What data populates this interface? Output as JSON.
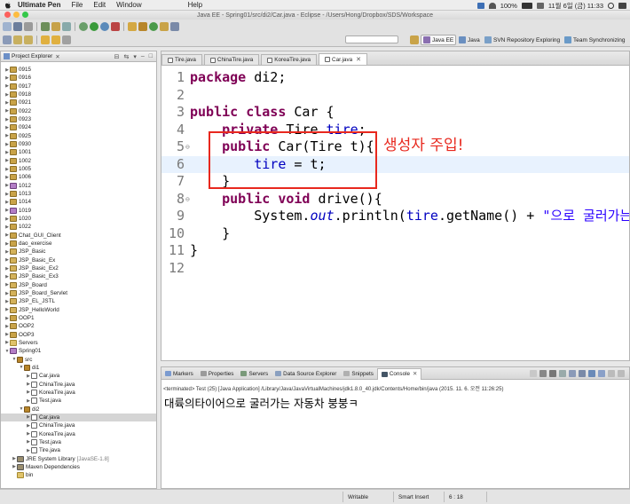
{
  "menubar": {
    "app_name": "Ultimate Pen",
    "items": [
      "File",
      "Edit",
      "Window",
      "Help"
    ],
    "battery": "100%",
    "datetime": "11월 6일 (금)  11:33"
  },
  "window": {
    "title": "Java EE - Spring01/src/di2/Car.java - Eclipse - /Users/Hong/Dropbox/SDS/Workspace"
  },
  "perspectives": [
    {
      "label": "Java EE",
      "active": true
    },
    {
      "label": "Java",
      "active": false
    },
    {
      "label": "SVN Repository Exploring",
      "active": false
    },
    {
      "label": "Team Synchronizing",
      "active": false
    }
  ],
  "explorer": {
    "title": "Project Explorer",
    "tree": [
      {
        "label": "0915",
        "depth": 0,
        "twisty": "▶",
        "icon": "project"
      },
      {
        "label": "0916",
        "depth": 0,
        "twisty": "▶",
        "icon": "project"
      },
      {
        "label": "0917",
        "depth": 0,
        "twisty": "▶",
        "icon": "project"
      },
      {
        "label": "0918",
        "depth": 0,
        "twisty": "▶",
        "icon": "project"
      },
      {
        "label": "0921",
        "depth": 0,
        "twisty": "▶",
        "icon": "project"
      },
      {
        "label": "0922",
        "depth": 0,
        "twisty": "▶",
        "icon": "project"
      },
      {
        "label": "0923",
        "depth": 0,
        "twisty": "▶",
        "icon": "project"
      },
      {
        "label": "0924",
        "depth": 0,
        "twisty": "▶",
        "icon": "project"
      },
      {
        "label": "0925",
        "depth": 0,
        "twisty": "▶",
        "icon": "project"
      },
      {
        "label": "0930",
        "depth": 0,
        "twisty": "▶",
        "icon": "project"
      },
      {
        "label": "1001",
        "depth": 0,
        "twisty": "▶",
        "icon": "project"
      },
      {
        "label": "1002",
        "depth": 0,
        "twisty": "▶",
        "icon": "project"
      },
      {
        "label": "1005",
        "depth": 0,
        "twisty": "▶",
        "icon": "project"
      },
      {
        "label": "1006",
        "depth": 0,
        "twisty": "▶",
        "icon": "project"
      },
      {
        "label": "1012",
        "depth": 0,
        "twisty": "▶",
        "icon": "jproject"
      },
      {
        "label": "1013",
        "depth": 0,
        "twisty": "▶",
        "icon": "project"
      },
      {
        "label": "1014",
        "depth": 0,
        "twisty": "▶",
        "icon": "project"
      },
      {
        "label": "1019",
        "depth": 0,
        "twisty": "▶",
        "icon": "jproject"
      },
      {
        "label": "1020",
        "depth": 0,
        "twisty": "▶",
        "icon": "project"
      },
      {
        "label": "1022",
        "depth": 0,
        "twisty": "▶",
        "icon": "project"
      },
      {
        "label": "Chat_GUI_Client",
        "depth": 0,
        "twisty": "▶",
        "icon": "project"
      },
      {
        "label": "dao_exercise",
        "depth": 0,
        "twisty": "▶",
        "icon": "project"
      },
      {
        "label": "JSP_Basic",
        "depth": 0,
        "twisty": "▶",
        "icon": "webproject"
      },
      {
        "label": "JSP_Basic_Ex",
        "depth": 0,
        "twisty": "▶",
        "icon": "webproject"
      },
      {
        "label": "JSP_Basic_Ex2",
        "depth": 0,
        "twisty": "▶",
        "icon": "webproject"
      },
      {
        "label": "JSP_Basic_Ex3",
        "depth": 0,
        "twisty": "▶",
        "icon": "webproject"
      },
      {
        "label": "JSP_Board",
        "depth": 0,
        "twisty": "▶",
        "icon": "webproject"
      },
      {
        "label": "JSP_Board_Servlet",
        "depth": 0,
        "twisty": "▶",
        "icon": "webproject"
      },
      {
        "label": "JSP_EL_JSTL",
        "depth": 0,
        "twisty": "▶",
        "icon": "webproject"
      },
      {
        "label": "JSP_HelloWorld",
        "depth": 0,
        "twisty": "▶",
        "icon": "webproject"
      },
      {
        "label": "OOP1",
        "depth": 0,
        "twisty": "▶",
        "icon": "project"
      },
      {
        "label": "OOP2",
        "depth": 0,
        "twisty": "▶",
        "icon": "project"
      },
      {
        "label": "OOP3",
        "depth": 0,
        "twisty": "▶",
        "icon": "project"
      },
      {
        "label": "Servers",
        "depth": 0,
        "twisty": "▶",
        "icon": "folder"
      },
      {
        "label": "Spring01",
        "depth": 0,
        "twisty": "▼",
        "icon": "jproject"
      },
      {
        "label": "src",
        "depth": 1,
        "twisty": "▼",
        "icon": "pkg"
      },
      {
        "label": "di1",
        "depth": 2,
        "twisty": "▼",
        "icon": "pkg"
      },
      {
        "label": "Car.java",
        "depth": 3,
        "twisty": "▶",
        "icon": "java"
      },
      {
        "label": "ChinaTire.java",
        "depth": 3,
        "twisty": "▶",
        "icon": "java"
      },
      {
        "label": "KoreaTire.java",
        "depth": 3,
        "twisty": "▶",
        "icon": "java"
      },
      {
        "label": "Test.java",
        "depth": 3,
        "twisty": "▶",
        "icon": "java"
      },
      {
        "label": "di2",
        "depth": 2,
        "twisty": "▼",
        "icon": "pkg"
      },
      {
        "label": "Car.java",
        "depth": 3,
        "twisty": "▶",
        "icon": "java",
        "selected": true
      },
      {
        "label": "ChinaTire.java",
        "depth": 3,
        "twisty": "▶",
        "icon": "java"
      },
      {
        "label": "KoreaTire.java",
        "depth": 3,
        "twisty": "▶",
        "icon": "java"
      },
      {
        "label": "Test.java",
        "depth": 3,
        "twisty": "▶",
        "icon": "java"
      },
      {
        "label": "Tire.java",
        "depth": 3,
        "twisty": "▶",
        "icon": "java"
      },
      {
        "label": "JRE System Library",
        "depth": 1,
        "twisty": "▶",
        "icon": "lib",
        "deco": "[JavaSE-1.8]"
      },
      {
        "label": "Maven Dependencies",
        "depth": 1,
        "twisty": "▶",
        "icon": "lib"
      },
      {
        "label": "bin",
        "depth": 1,
        "twisty": "",
        "icon": "folder"
      }
    ]
  },
  "editor": {
    "tabs": [
      {
        "label": "Tire.java",
        "active": false
      },
      {
        "label": "ChinaTire.java",
        "active": false
      },
      {
        "label": "KoreaTire.java",
        "active": false
      },
      {
        "label": "Car.java",
        "active": true
      }
    ],
    "lines": [
      {
        "num": "1",
        "fold": "",
        "tokens": [
          [
            "kw",
            "package"
          ],
          [
            "",
            " di2;"
          ]
        ]
      },
      {
        "num": "2",
        "fold": "",
        "tokens": []
      },
      {
        "num": "3",
        "fold": "",
        "tokens": [
          [
            "kw",
            "public"
          ],
          [
            "",
            " "
          ],
          [
            "kw",
            "class"
          ],
          [
            "",
            " Car {"
          ]
        ]
      },
      {
        "num": "4",
        "fold": "",
        "tokens": [
          [
            "",
            "    "
          ],
          [
            "kw",
            "private"
          ],
          [
            "",
            " Tire "
          ],
          [
            "fld",
            "tire"
          ],
          [
            "",
            ";"
          ]
        ]
      },
      {
        "num": "5",
        "fold": "⊖",
        "tokens": [
          [
            "",
            "    "
          ],
          [
            "kw",
            "public"
          ],
          [
            "",
            " Car(Tire "
          ],
          [
            "",
            "t"
          ],
          [
            "",
            "){"
          ]
        ]
      },
      {
        "num": "6",
        "fold": "",
        "current": true,
        "tokens": [
          [
            "",
            "        "
          ],
          [
            "fld",
            "tire"
          ],
          [
            "",
            " = t;"
          ]
        ]
      },
      {
        "num": "7",
        "fold": "",
        "tokens": [
          [
            "",
            "    }"
          ]
        ]
      },
      {
        "num": "8",
        "fold": "⊖",
        "tokens": [
          [
            "",
            "    "
          ],
          [
            "kw",
            "public"
          ],
          [
            "",
            " "
          ],
          [
            "kw",
            "void"
          ],
          [
            "",
            " drive(){"
          ]
        ]
      },
      {
        "num": "9",
        "fold": "",
        "tokens": [
          [
            "",
            "        System."
          ],
          [
            "st",
            "out"
          ],
          [
            "",
            ".println("
          ],
          [
            "fld",
            "tire"
          ],
          [
            "",
            ".getName() + "
          ],
          [
            "str",
            "\"으로 굴러가는 자"
          ]
        ]
      },
      {
        "num": "10",
        "fold": "",
        "tokens": [
          [
            "",
            "    }"
          ]
        ]
      },
      {
        "num": "11",
        "fold": "",
        "tokens": [
          [
            "",
            "}"
          ]
        ]
      },
      {
        "num": "12",
        "fold": "",
        "tokens": []
      }
    ],
    "annotation": "생성자 주입!"
  },
  "console": {
    "tabs": [
      {
        "label": "Markers",
        "active": false,
        "color": "#7b9bd0"
      },
      {
        "label": "Properties",
        "active": false,
        "color": "#9a9a9a"
      },
      {
        "label": "Servers",
        "active": false,
        "color": "#7a9a7a"
      },
      {
        "label": "Data Source Explorer",
        "active": false,
        "color": "#8aa0c0"
      },
      {
        "label": "Snippets",
        "active": false,
        "color": "#b0b0b0"
      },
      {
        "label": "Console",
        "active": true,
        "color": "#445566"
      }
    ],
    "status": "<terminated> Test (25) [Java Application] /Library/Java/JavaVirtualMachines/jdk1.8.0_40.jdk/Contents/Home/bin/java (2015. 11. 6. 오전 11:26:25)",
    "output": "대륙의타이어으로 굴러가는 자동차 붕붕ㅋ"
  },
  "statusbar": {
    "writable": "Writable",
    "insert_mode": "Smart Insert",
    "position": "6 : 18"
  }
}
